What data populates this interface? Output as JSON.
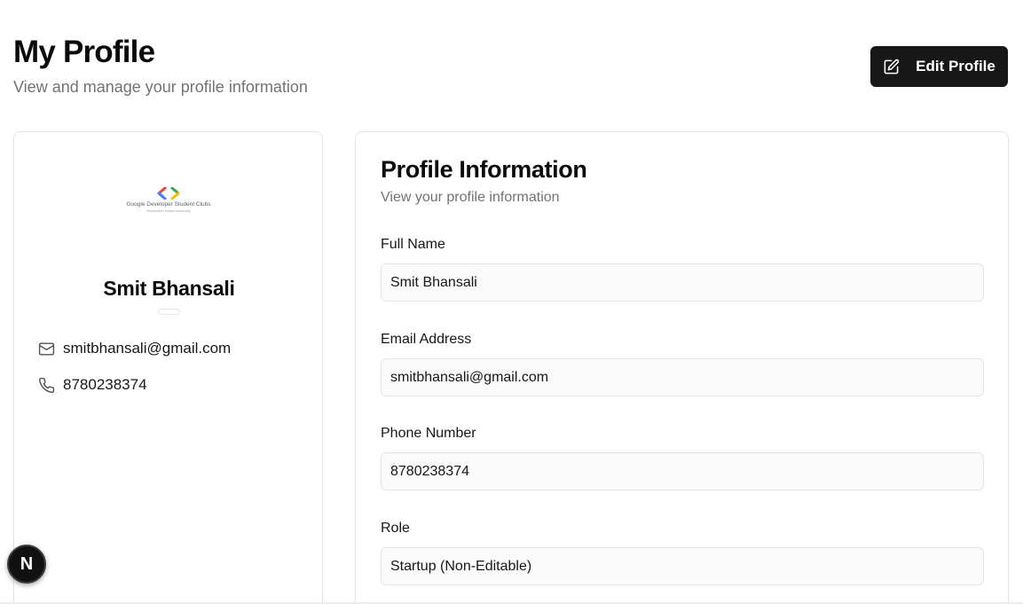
{
  "header": {
    "title": "My Profile",
    "subtitle": "View and manage your profile information",
    "edit_button_label": "Edit Profile",
    "edit_icon": "edit-icon"
  },
  "sidebar_card": {
    "logo": {
      "name": "Google Developer Student Clubs",
      "subtext": "Dharmsinh Desai University"
    },
    "name": "Smit Bhansali",
    "email": "smitbhansali@gmail.com",
    "email_icon": "mail-icon",
    "phone": "8780238374",
    "phone_icon": "phone-icon"
  },
  "profile_info": {
    "title": "Profile Information",
    "subtitle": "View your profile information",
    "fields": [
      {
        "label": "Full Name",
        "value": "Smit Bhansali"
      },
      {
        "label": "Email Address",
        "value": "smitbhansali@gmail.com"
      },
      {
        "label": "Phone Number",
        "value": "8780238374"
      },
      {
        "label": "Role",
        "value": "Startup (Non-Editable)"
      }
    ]
  },
  "dev_badge": {
    "letter": "N"
  },
  "colors": {
    "primary_button": "#171717",
    "muted_text": "#737373",
    "border": "#e5e5e5",
    "input_bg": "#fafafa"
  }
}
